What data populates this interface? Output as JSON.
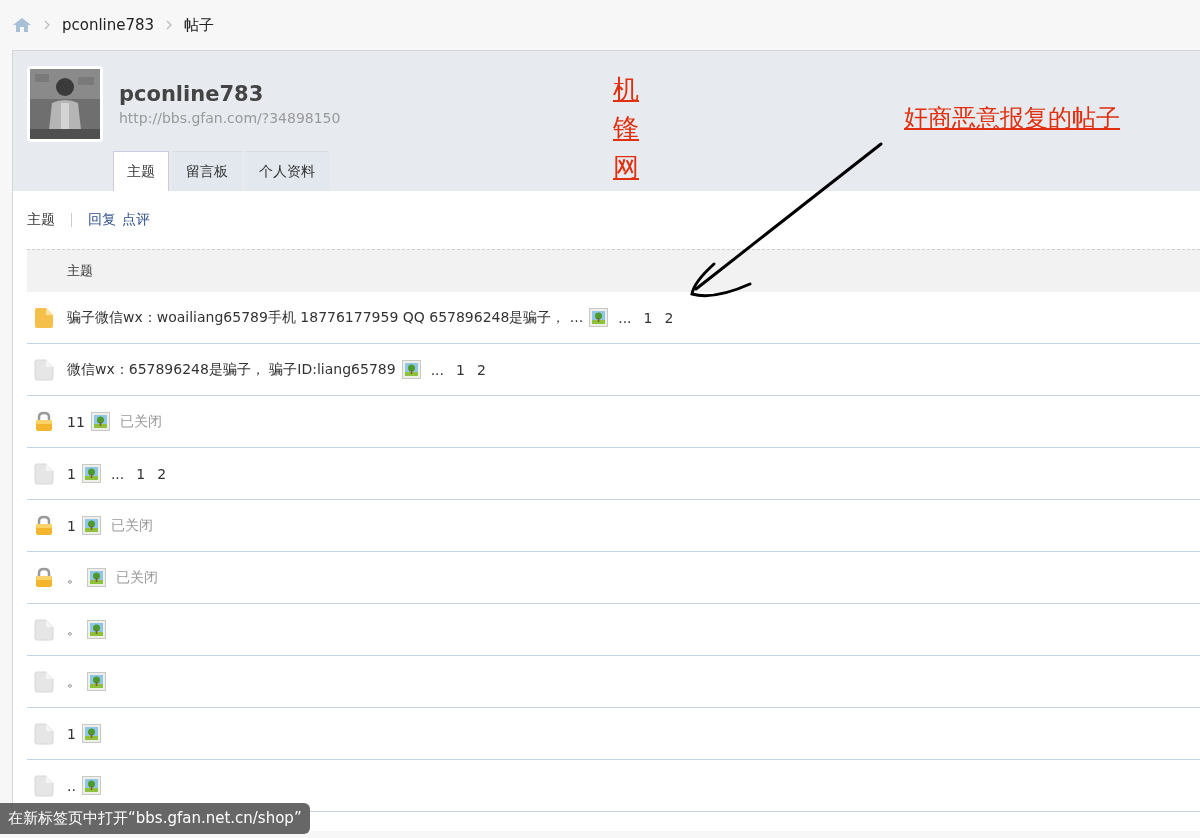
{
  "breadcrumb": [
    "pconline783",
    "帖子"
  ],
  "profile": {
    "name": "pconline783",
    "url": "http://bbs.gfan.com/?34898150"
  },
  "tabs": [
    {
      "label": "主题",
      "selected": true
    },
    {
      "label": "留言板",
      "selected": false
    },
    {
      "label": "个人资料",
      "selected": false
    }
  ],
  "filter": [
    {
      "label": "主题",
      "selected": true
    },
    {
      "label": "回复",
      "selected": false
    },
    {
      "label": "点评",
      "selected": false
    }
  ],
  "table": {
    "header": "主题",
    "rows": [
      {
        "kind": "folder",
        "title": "骗子微信wx：woailiang65789手机 18776177959 QQ 657896248是骗子， ...",
        "more": "...",
        "pages": [
          "1",
          "2"
        ]
      },
      {
        "kind": "doc",
        "title": "微信wx：657896248是骗子， 骗子ID:liang65789",
        "more": "...",
        "pages": [
          "1",
          "2"
        ]
      },
      {
        "kind": "lock",
        "title": "11",
        "status": "已关闭"
      },
      {
        "kind": "doc",
        "title": "1",
        "more": "...",
        "pages": [
          "1",
          "2"
        ]
      },
      {
        "kind": "lock",
        "title": "1",
        "status": "已关闭"
      },
      {
        "kind": "lock",
        "title": "。",
        "status": "已关闭"
      },
      {
        "kind": "doc",
        "title": "。"
      },
      {
        "kind": "doc",
        "title": "。"
      },
      {
        "kind": "doc",
        "title": "1"
      },
      {
        "kind": "doc",
        "title": ".."
      }
    ]
  },
  "annotations": {
    "vertical_label": "机锋网",
    "caption": "奸商恶意报复的帖子"
  },
  "status_bubble": "在新标签页中打开“bbs.gfan.net.cn/shop”"
}
